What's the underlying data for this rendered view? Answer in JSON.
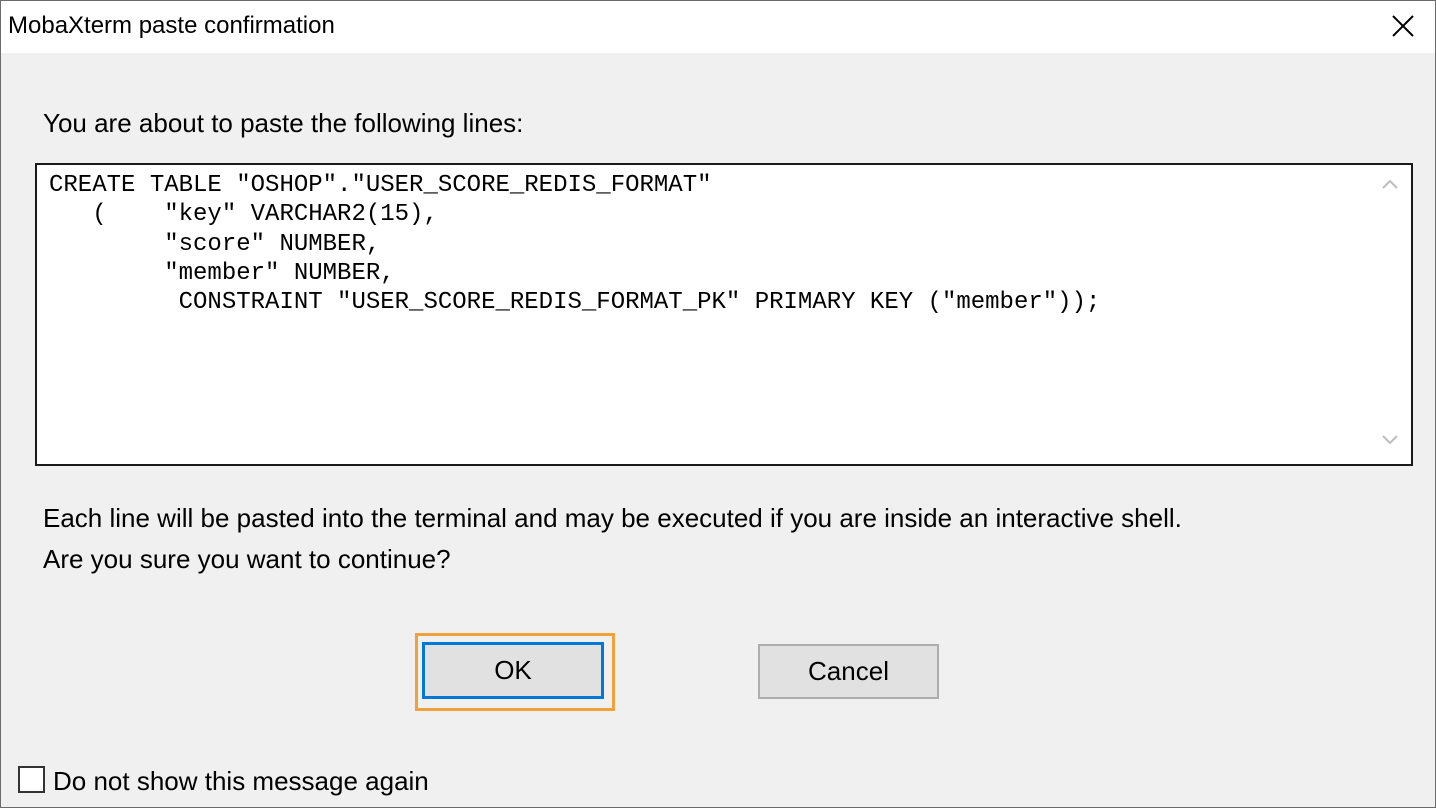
{
  "window": {
    "title": "MobaXterm paste confirmation"
  },
  "dialog": {
    "prompt": "You are about to paste the following lines:",
    "paste_lines": [
      "CREATE TABLE \"OSHOP\".\"USER_SCORE_REDIS_FORMAT\"",
      "   (    \"key\" VARCHAR2(15),",
      "        \"score\" NUMBER,",
      "        \"member\" NUMBER,",
      "         CONSTRAINT \"USER_SCORE_REDIS_FORMAT_PK\" PRIMARY KEY (\"member\"));"
    ],
    "info_line_1": "Each line will be pasted into the terminal and may be executed if you are inside an interactive shell.",
    "info_line_2": "Are you sure you want to continue?",
    "ok_label": "OK",
    "cancel_label": "Cancel",
    "dont_show_label": "Do not show this message again",
    "dont_show_checked": false
  },
  "icons": {
    "close": "close-icon",
    "scroll_up": "chevron-up-icon",
    "scroll_down": "chevron-down-icon"
  },
  "colors": {
    "focus_ring": "#f0a13a",
    "default_button_border": "#0078d7",
    "dialog_background": "#f0f0f0"
  }
}
